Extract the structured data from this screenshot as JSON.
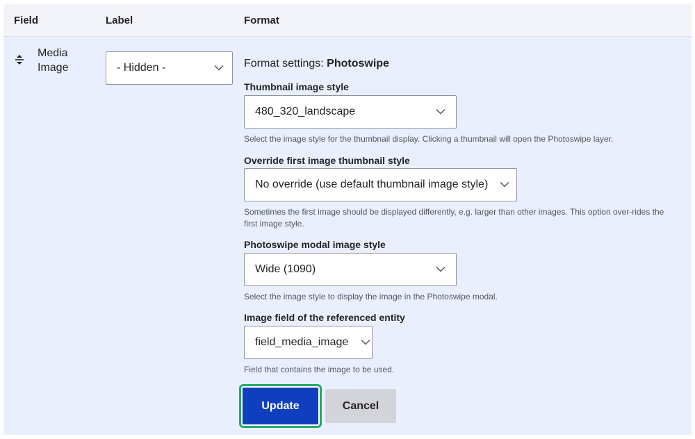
{
  "table": {
    "headers": {
      "field": "Field",
      "label": "Label",
      "format": "Format"
    }
  },
  "row": {
    "field_name_line1": "Media",
    "field_name_line2": "Image",
    "drag_icon": "drag-arrows-icon",
    "label_select": {
      "value": "- Hidden -"
    },
    "format_title_prefix": "Format settings: ",
    "format_title_name": "Photoswipe",
    "thumbnail": {
      "label": "Thumbnail image style",
      "value": "480_320_landscape",
      "description": "Select the image style for the thumbnail display. Clicking a thumbnail will open the Photoswipe layer."
    },
    "override": {
      "label": "Override first image thumbnail style",
      "value": "No override (use default thumbnail image style)",
      "description": "Sometimes the first image should be displayed differently, e.g. larger than other images. This option over-rides the first image style."
    },
    "modal": {
      "label": "Photoswipe modal image style",
      "value": "Wide (1090)",
      "description": "Select the image style to display the image in the Photoswipe modal."
    },
    "image_field": {
      "label": "Image field of the referenced entity",
      "value": "field_media_image",
      "description": "Field that contains the image to be used."
    },
    "buttons": {
      "update": "Update",
      "cancel": "Cancel"
    }
  },
  "colors": {
    "primary_button": "#0f3fbf",
    "focus_ring": "#26a769",
    "row_background": "#e9effc",
    "header_background": "#f3f4f9"
  }
}
